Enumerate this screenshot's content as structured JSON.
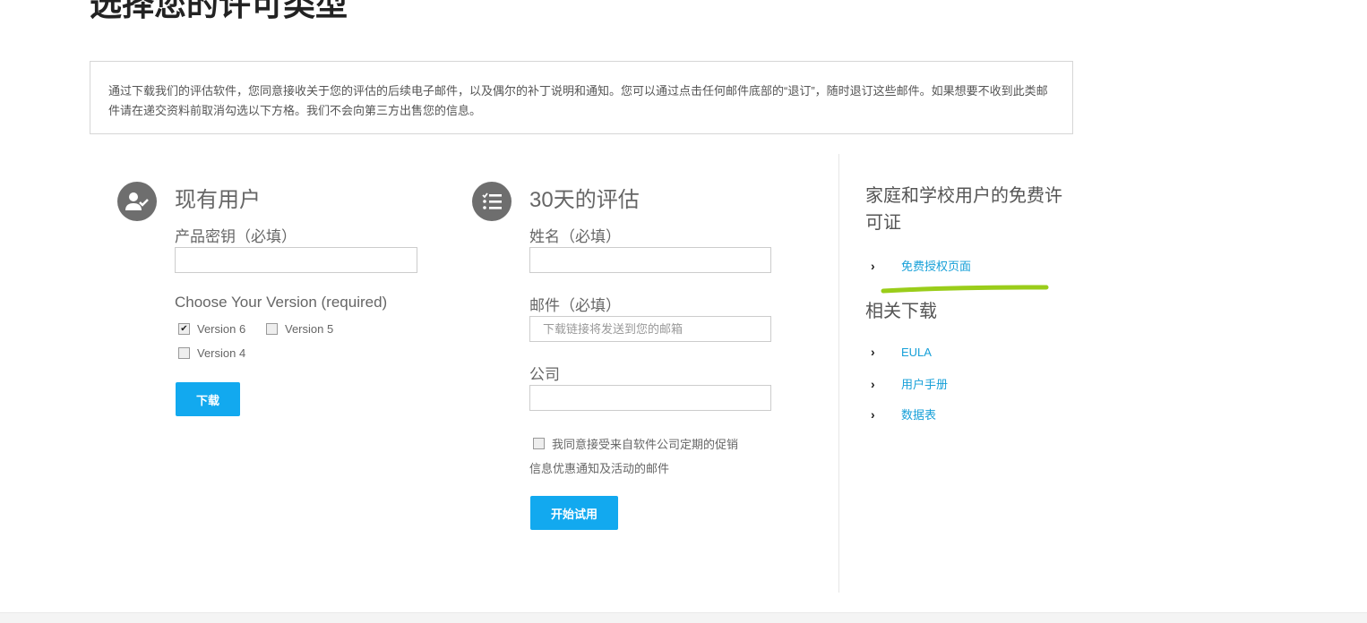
{
  "page_title": "选择您的许可类型",
  "notice": "通过下载我们的评估软件，您同意接收关于您的评估的后续电子邮件，以及偶尔的补丁说明和通知。您可以通过点击任何邮件底部的“退订”，随时退订这些邮件。如果想要不收到此类邮件请在递交资料前取消勾选以下方格。我们不会向第三方出售您的信息。",
  "existing_user": {
    "heading": "现有用户",
    "product_key_label": "产品密钥（必填）",
    "product_key_value": "",
    "version_label": "Choose Your Version (required)",
    "versions": [
      {
        "label": "Version 6",
        "checked": true
      },
      {
        "label": "Version 5",
        "checked": false
      },
      {
        "label": "Version 4",
        "checked": false
      }
    ],
    "download_button": "下载"
  },
  "trial": {
    "heading": "30天的评估",
    "name_label": "姓名（必填）",
    "name_value": "",
    "email_label": "邮件（必填）",
    "email_placeholder": "下载链接将发送到您的邮箱",
    "company_label": "公司",
    "company_value": "",
    "consent_text": "我同意接受来自软件公司定期的促销",
    "consent_text_2": "信息优惠通知及活动的邮件",
    "consent_checked": false,
    "start_button": "开始试用"
  },
  "sidebar": {
    "free_heading": "家庭和学校用户的免费许可证",
    "free_links": [
      {
        "label": "免费授权页面"
      }
    ],
    "downloads_heading": "相关下载",
    "download_links": [
      {
        "label": "EULA"
      },
      {
        "label": "用户手册"
      },
      {
        "label": "数据表"
      }
    ]
  },
  "colors": {
    "accent": "#12a9ef",
    "link": "#17a0d8",
    "highlight": "#9acd1a"
  }
}
